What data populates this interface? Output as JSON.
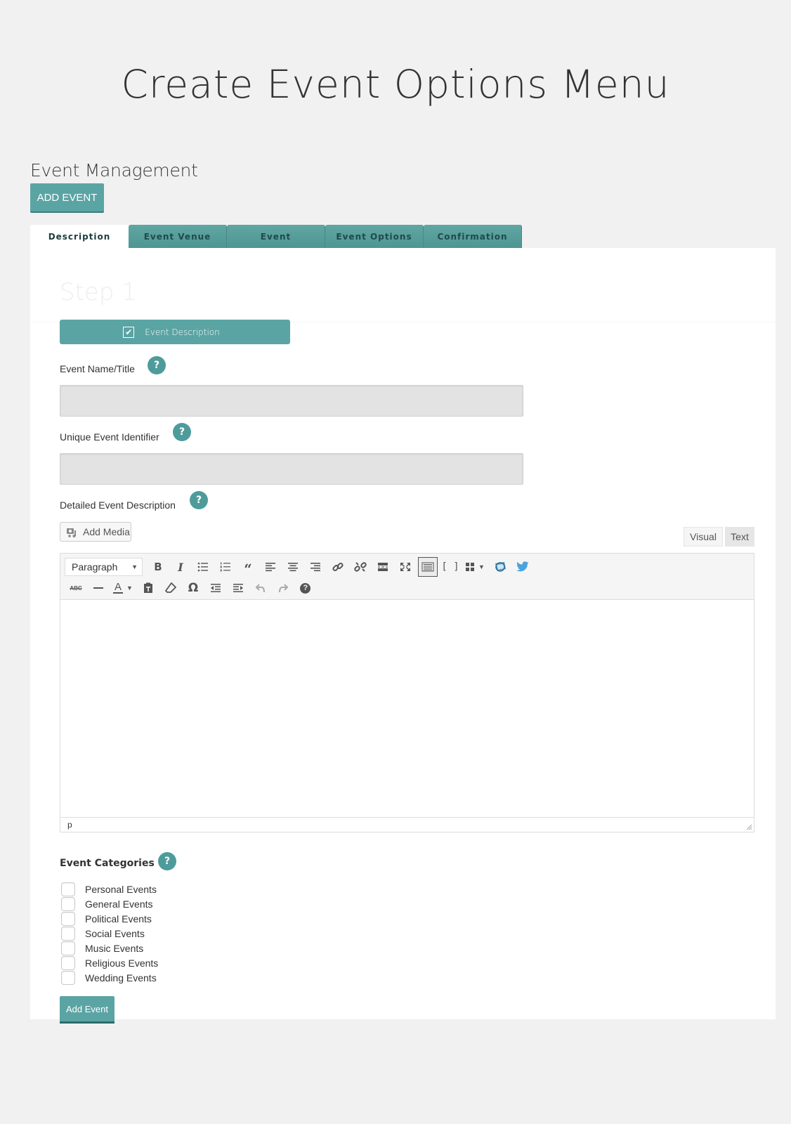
{
  "page_heading": "Create Event Options Menu",
  "section_title": "Event Management",
  "add_event_top_label": "ADD EVENT",
  "tabs": [
    {
      "label": "Description",
      "active": true
    },
    {
      "label": "Event Venue",
      "active": false
    },
    {
      "label": "Event",
      "active": false
    },
    {
      "label": "Event Options",
      "active": false
    },
    {
      "label": "Confirmation",
      "active": false
    }
  ],
  "step": {
    "title": "Step 1",
    "bar_label": "Event Description",
    "bar_checked": true
  },
  "fields": {
    "event_name": {
      "label": "Event Name/Title",
      "value": "",
      "help": "?"
    },
    "unique_id": {
      "label": "Unique Event Identifier",
      "value": "",
      "help": "?"
    },
    "description": {
      "label": "Detailed Event Description",
      "help": "?"
    }
  },
  "editor": {
    "add_media_label": "Add Media",
    "mode_visual": "Visual",
    "mode_text": "Text",
    "format_select": "Paragraph",
    "toolbar_row1": [
      "bold-icon",
      "italic-icon",
      "bullet-list-icon",
      "numbered-list-icon",
      "blockquote-icon",
      "align-left-icon",
      "align-center-icon",
      "align-right-icon",
      "link-icon",
      "unlink-icon",
      "read-more-icon",
      "fullscreen-icon",
      "toolbar-toggle-icon",
      "shortcode-icon",
      "grid-icon",
      "plugin-icon",
      "twitter-icon"
    ],
    "toolbar_row2": [
      "strikethrough-icon",
      "horizontal-line-icon",
      "text-color-icon",
      "paste-text-icon",
      "clear-formatting-icon",
      "special-character-icon",
      "outdent-icon",
      "indent-icon",
      "undo-icon",
      "redo-icon",
      "help-icon"
    ],
    "content": "",
    "status_path": "p"
  },
  "categories": {
    "heading": "Event Categories",
    "help": "?",
    "items": [
      {
        "label": "Personal Events",
        "checked": false
      },
      {
        "label": "General Events",
        "checked": false
      },
      {
        "label": "Political Events",
        "checked": false
      },
      {
        "label": "Social Events",
        "checked": false
      },
      {
        "label": "Music Events",
        "checked": false
      },
      {
        "label": "Religious Events",
        "checked": false
      },
      {
        "label": "Wedding Events",
        "checked": false
      }
    ]
  },
  "add_event_bottom_label": "Add Event",
  "colors": {
    "accent": "#5ba4a4",
    "background": "#f1f1f1",
    "input_fill": "#e3e3e3"
  }
}
